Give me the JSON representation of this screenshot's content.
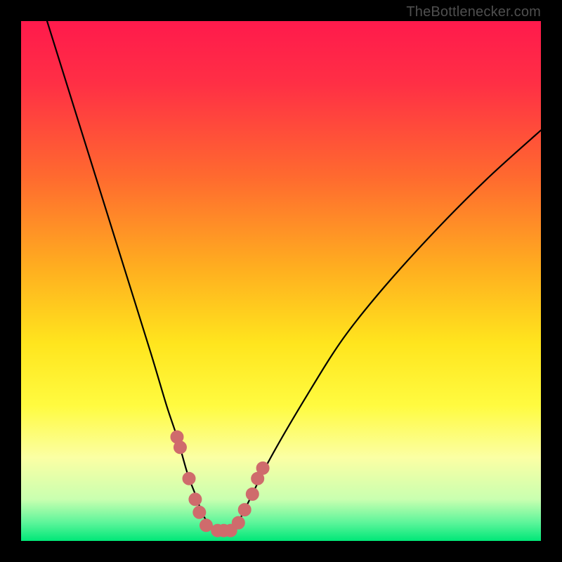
{
  "watermark": {
    "text": "TheBottlenecker.com"
  },
  "colors": {
    "frame": "#000000",
    "curve": "#000000",
    "marker_fill": "#cf6b6c",
    "marker_stroke": "#cf6b6c",
    "gradient_stops": [
      {
        "offset": 0.0,
        "color": "#ff1a4c"
      },
      {
        "offset": 0.12,
        "color": "#ff2f45"
      },
      {
        "offset": 0.3,
        "color": "#ff6a2f"
      },
      {
        "offset": 0.48,
        "color": "#ffb01f"
      },
      {
        "offset": 0.62,
        "color": "#ffe51e"
      },
      {
        "offset": 0.74,
        "color": "#fffb40"
      },
      {
        "offset": 0.84,
        "color": "#fbffa4"
      },
      {
        "offset": 0.92,
        "color": "#c9ffb0"
      },
      {
        "offset": 0.965,
        "color": "#5cf59a"
      },
      {
        "offset": 1.0,
        "color": "#00e778"
      }
    ]
  },
  "chart_data": {
    "type": "line",
    "title": "",
    "xlabel": "",
    "ylabel": "",
    "xlim": [
      0,
      100
    ],
    "ylim": [
      0,
      100
    ],
    "grid": false,
    "legend": false,
    "series": [
      {
        "name": "bottleneck-curve",
        "x": [
          5,
          10,
          15,
          20,
          25,
          28,
          30,
          32,
          33.5,
          35,
          36.5,
          38,
          39,
          40,
          41,
          42,
          44,
          48,
          55,
          62,
          70,
          80,
          90,
          100
        ],
        "values": [
          100,
          84,
          68,
          52,
          36,
          26,
          20,
          13,
          9,
          5,
          3,
          2,
          2,
          2,
          2.5,
          4,
          8,
          16,
          28,
          39,
          49,
          60,
          70,
          79
        ]
      }
    ],
    "markers": [
      {
        "x": 30.0,
        "y": 20.0
      },
      {
        "x": 30.6,
        "y": 18.0
      },
      {
        "x": 32.3,
        "y": 12.0
      },
      {
        "x": 33.5,
        "y": 8.0
      },
      {
        "x": 34.3,
        "y": 5.5
      },
      {
        "x": 35.6,
        "y": 3.0
      },
      {
        "x": 37.8,
        "y": 2.0
      },
      {
        "x": 39.0,
        "y": 2.0
      },
      {
        "x": 40.3,
        "y": 2.0
      },
      {
        "x": 41.8,
        "y": 3.5
      },
      {
        "x": 43.0,
        "y": 6.0
      },
      {
        "x": 44.5,
        "y": 9.0
      },
      {
        "x": 45.5,
        "y": 12.0
      },
      {
        "x": 46.5,
        "y": 14.0
      }
    ],
    "marker_radius_px": 9
  }
}
